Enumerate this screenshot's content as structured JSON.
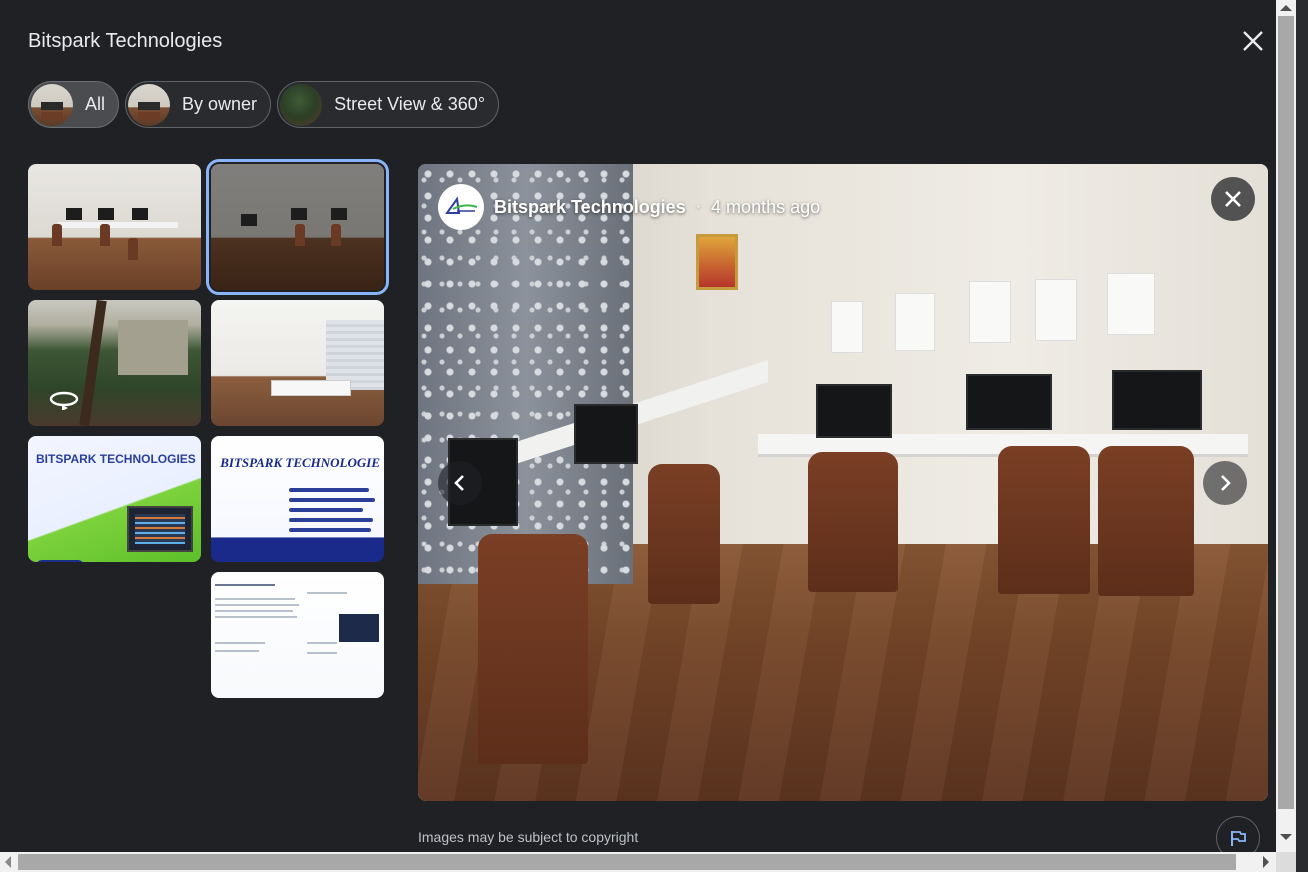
{
  "dialog": {
    "title": "Bitspark Technologies",
    "close_icon": "close-icon"
  },
  "filters": [
    {
      "label": "All",
      "active": true
    },
    {
      "label": "By owner",
      "active": false
    },
    {
      "label": "Street View & 360°",
      "active": false
    }
  ],
  "thumbnails": [
    {
      "kind": "office-photo"
    },
    {
      "kind": "office-photo",
      "selected": true
    },
    {
      "kind": "street-view-360",
      "icon": "360-pano-icon"
    },
    {
      "kind": "cabin-photo"
    },
    {
      "kind": "flyer-green",
      "heading": "BITSPARK TECHNOLOGIES"
    },
    {
      "kind": "flyer-blue",
      "heading": "BITSPARK TECHNOLOGIE"
    },
    {
      "kind": "flyer-doc"
    }
  ],
  "viewer": {
    "author": "Bitspark Technologies",
    "separator": "·",
    "posted": "4 months ago",
    "close_icon": "close-icon",
    "prev_icon": "chevron-left-icon",
    "next_icon": "chevron-right-icon"
  },
  "footer": {
    "copyright": "Images may be subject to copyright",
    "report_icon": "flag-icon"
  },
  "colors": {
    "background": "#202124",
    "selected_outline": "#8ab4f8",
    "text": "#e8eaed"
  }
}
